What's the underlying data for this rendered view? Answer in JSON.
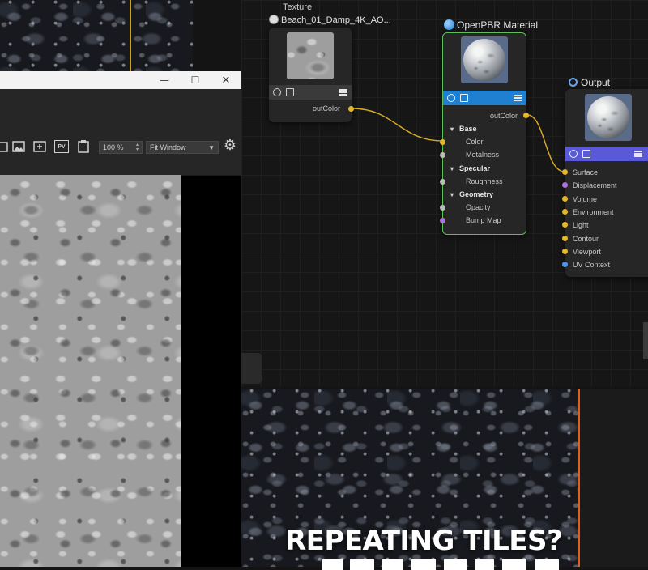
{
  "colors": {
    "wire": "#d8ad2a",
    "material_border": "#5fbf5a",
    "material_bar": "#1f7fd0",
    "texture_bar": "#3a3a3a",
    "output_bar": "#5a5ad8",
    "render_edge": "#e06018"
  },
  "nodes": {
    "texture": {
      "header": "Texture",
      "title": "Beach_01_Damp_4K_AO...",
      "output_port": "outColor"
    },
    "material": {
      "title": "OpenPBR Material",
      "output_port": "outColor",
      "sections": [
        {
          "label": "Base",
          "ports": [
            "Color",
            "Metalness"
          ]
        },
        {
          "label": "Specular",
          "ports": [
            "Roughness"
          ]
        },
        {
          "label": "Geometry",
          "ports": [
            "Opacity",
            "Bump Map"
          ]
        }
      ]
    },
    "output": {
      "title": "Output",
      "ports": [
        "Surface",
        "Displacement",
        "Volume",
        "Environment",
        "Light",
        "Contour",
        "Viewport",
        "UV Context"
      ]
    }
  },
  "viewer": {
    "zoom_value": "100 %",
    "fit_mode": "Fit Window",
    "window_controls": {
      "minimize": "—",
      "maximize": "☐",
      "close": "✕"
    },
    "toolbar_icons": [
      "image-icon",
      "add-image-icon",
      "pv-icon",
      "clipboard-icon",
      "gear-icon"
    ],
    "pv_label": "PV"
  },
  "headline": {
    "line1": "REPEATING TILES?"
  }
}
